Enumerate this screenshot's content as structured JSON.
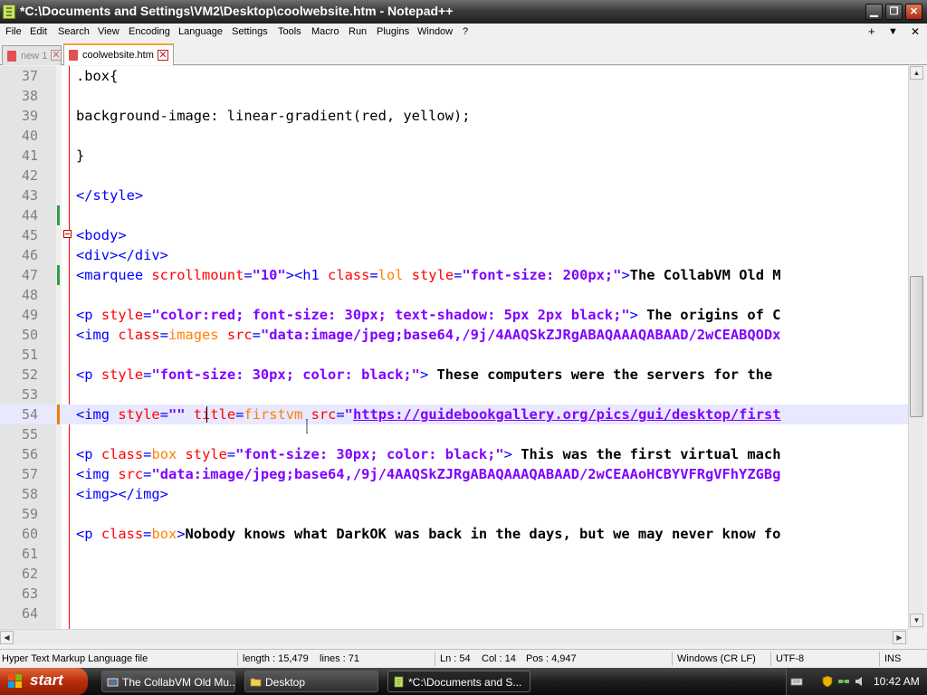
{
  "window": {
    "title": "*C:\\Documents and Settings\\VM2\\Desktop\\coolwebsite.htm - Notepad++",
    "minimize": "▁",
    "maximize": "❐",
    "close": "✕"
  },
  "menu": {
    "items": [
      "File",
      "Edit",
      "Search",
      "View",
      "Encoding",
      "Language",
      "Settings",
      "Tools",
      "Macro",
      "Run",
      "Plugins",
      "Window",
      "?"
    ],
    "right": [
      "+",
      "▼",
      "✕"
    ]
  },
  "tabs": [
    {
      "label": "new 1",
      "active": false,
      "close": "✕"
    },
    {
      "label": "coolwebsite.htm",
      "active": true,
      "close": "✕"
    }
  ],
  "editor": {
    "lines": [
      {
        "n": "37",
        "segs": [
          [
            "p",
            ".box{"
          ]
        ]
      },
      {
        "n": "38",
        "segs": []
      },
      {
        "n": "39",
        "segs": [
          [
            "p",
            "background-image: linear-gradient(red, yellow);"
          ]
        ]
      },
      {
        "n": "40",
        "segs": []
      },
      {
        "n": "41",
        "segs": [
          [
            "p",
            "}"
          ]
        ]
      },
      {
        "n": "42",
        "segs": []
      },
      {
        "n": "43",
        "segs": [
          [
            "t",
            "</style>"
          ]
        ]
      },
      {
        "n": "44",
        "segs": [],
        "change": "green"
      },
      {
        "n": "45",
        "segs": [
          [
            "t",
            "<body>"
          ]
        ],
        "fold": true
      },
      {
        "n": "46",
        "segs": [
          [
            "t",
            "<div></div>"
          ]
        ]
      },
      {
        "n": "47",
        "segs": [
          [
            "t",
            "<marquee "
          ],
          [
            "a",
            "scrollmount"
          ],
          [
            "t",
            "="
          ],
          [
            "v",
            "\"10\""
          ],
          [
            "t",
            "><h1 "
          ],
          [
            "a",
            "class"
          ],
          [
            "t",
            "="
          ],
          [
            "k",
            "lol"
          ],
          [
            "t",
            " "
          ],
          [
            "a",
            "style"
          ],
          [
            "t",
            "="
          ],
          [
            "v",
            "\"font-size: 200px;\""
          ],
          [
            "t",
            ">"
          ],
          [
            "b",
            "The CollabVM Old M"
          ]
        ],
        "change": "green"
      },
      {
        "n": "48",
        "segs": []
      },
      {
        "n": "49",
        "segs": [
          [
            "t",
            "<p "
          ],
          [
            "a",
            "style"
          ],
          [
            "t",
            "="
          ],
          [
            "v",
            "\"color:red; font-size: 30px; text-shadow: 5px 2px black;\""
          ],
          [
            "t",
            ">"
          ],
          [
            "b",
            " The origins of C"
          ]
        ]
      },
      {
        "n": "50",
        "segs": [
          [
            "t",
            "<img "
          ],
          [
            "a",
            "class"
          ],
          [
            "t",
            "="
          ],
          [
            "k",
            "images"
          ],
          [
            "t",
            " "
          ],
          [
            "a",
            "src"
          ],
          [
            "t",
            "="
          ],
          [
            "v",
            "\"data:image/jpeg;base64,/9j/4AAQSkZJRgABAQAAAQABAAD/2wCEABQODx"
          ]
        ]
      },
      {
        "n": "51",
        "segs": []
      },
      {
        "n": "52",
        "segs": [
          [
            "t",
            "<p "
          ],
          [
            "a",
            "style"
          ],
          [
            "t",
            "="
          ],
          [
            "v",
            "\"font-size: 30px; color: black;\""
          ],
          [
            "t",
            ">"
          ],
          [
            "b",
            " These computers were the servers for the "
          ]
        ]
      },
      {
        "n": "53",
        "segs": []
      },
      {
        "n": "54",
        "segs": [
          [
            "t",
            "<img "
          ],
          [
            "a",
            "style"
          ],
          [
            "t",
            "="
          ],
          [
            "v",
            "\"\""
          ],
          [
            "t",
            " "
          ],
          [
            "a",
            "title"
          ],
          [
            "t",
            "="
          ],
          [
            "k",
            "firstvm"
          ],
          [
            "t",
            " "
          ],
          [
            "a",
            "src"
          ],
          [
            "t",
            "="
          ],
          [
            "v",
            "\""
          ],
          [
            "u",
            "https://guidebookgallery.org/pics/gui/desktop/first"
          ]
        ],
        "change": "orange",
        "current": true
      },
      {
        "n": "55",
        "segs": []
      },
      {
        "n": "56",
        "segs": [
          [
            "t",
            "<p "
          ],
          [
            "a",
            "class"
          ],
          [
            "t",
            "="
          ],
          [
            "k",
            "box"
          ],
          [
            "t",
            " "
          ],
          [
            "a",
            "style"
          ],
          [
            "t",
            "="
          ],
          [
            "v",
            "\"font-size: 30px; color: black;\""
          ],
          [
            "t",
            ">"
          ],
          [
            "b",
            " This was the first virtual mach"
          ]
        ]
      },
      {
        "n": "57",
        "segs": [
          [
            "t",
            "<img "
          ],
          [
            "a",
            "src"
          ],
          [
            "t",
            "="
          ],
          [
            "v",
            "\"data:image/jpeg;base64,/9j/4AAQSkZJRgABAQAAAQABAAD/2wCEAAoHCBYVFRgVFhYZGBg"
          ]
        ]
      },
      {
        "n": "58",
        "segs": [
          [
            "t",
            "<img></img>"
          ]
        ]
      },
      {
        "n": "59",
        "segs": []
      },
      {
        "n": "60",
        "segs": [
          [
            "t",
            "<p "
          ],
          [
            "a",
            "class"
          ],
          [
            "t",
            "="
          ],
          [
            "k",
            "box"
          ],
          [
            "t",
            ">"
          ],
          [
            "b",
            "Nobody knows what DarkOK was back in the days, but we may never know fo"
          ]
        ]
      },
      {
        "n": "61",
        "segs": []
      },
      {
        "n": "62",
        "segs": []
      },
      {
        "n": "63",
        "segs": []
      },
      {
        "n": "64",
        "segs": []
      }
    ]
  },
  "scroll": {
    "up": "▲",
    "down": "▼",
    "left": "◀",
    "right": "▶"
  },
  "status": {
    "filetype": "Hyper Text Markup Language file",
    "length": "length : 15,479",
    "lines": "lines : 71",
    "ln": "Ln : 54",
    "col": "Col : 14",
    "pos": "Pos : 4,947",
    "eol": "Windows (CR LF)",
    "encoding": "UTF-8",
    "mode": "INS"
  },
  "taskbar": {
    "start": "start",
    "tasks": [
      {
        "label": "The CollabVM Old Mu...",
        "active": false
      },
      {
        "label": "Desktop",
        "active": false
      },
      {
        "label": "*C:\\Documents and S...",
        "active": true
      }
    ],
    "clock": "10:42 AM"
  },
  "colors": {
    "tag": "#0000ff",
    "attr": "#ff0000",
    "value": "#8000ff",
    "keyword": "#ff8000",
    "edge": "#ff0000",
    "change_saved": "#2ea043",
    "change_unsaved": "#f07f00"
  }
}
